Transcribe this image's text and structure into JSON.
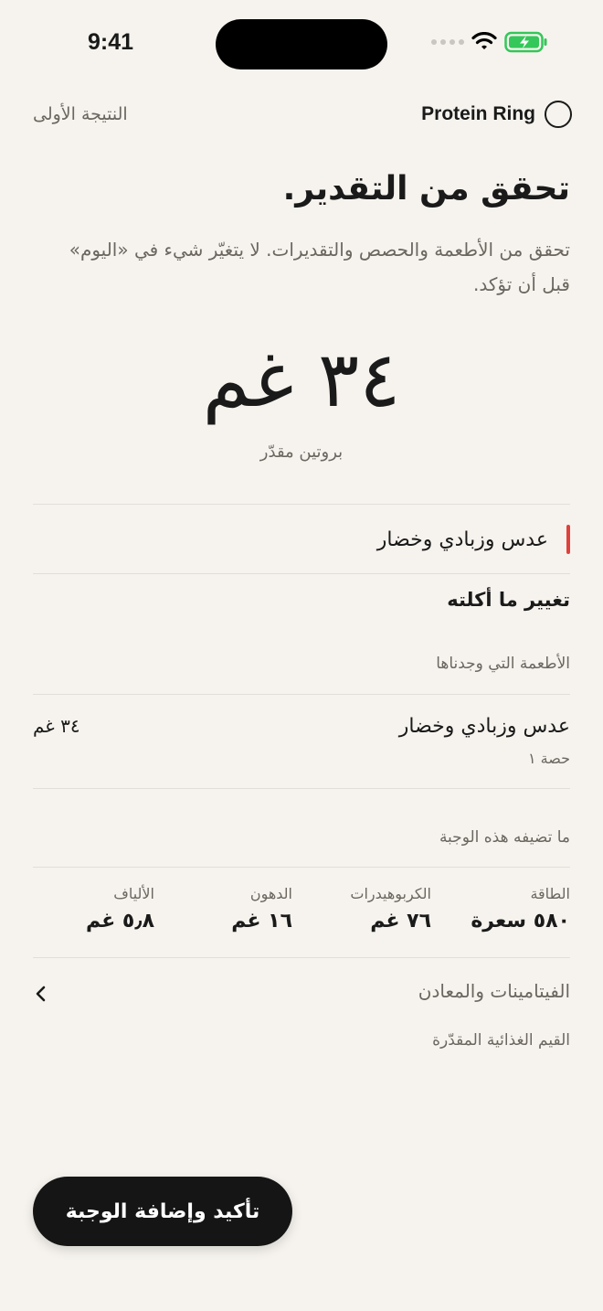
{
  "status": {
    "time": "9:41"
  },
  "header": {
    "brand": "Protein Ring",
    "first_result": "النتيجة الأولى"
  },
  "title": "تحقق من التقدير.",
  "subtitle": "تحقق من الأطعمة والحصص والتقديرات. لا يتغيّر شيء في «اليوم» قبل أن تؤكد.",
  "estimate": {
    "value": "٣٤ غم",
    "label": "بروتين مقدّر"
  },
  "meal": {
    "name": "عدس وزبادي وخضار",
    "accent_color": "#e0403c"
  },
  "change_label": "تغيير ما أكلته",
  "foods_section": {
    "label": "الأطعمة التي وجدناها",
    "items": [
      {
        "name": "عدس وزبادي وخضار",
        "portion": "حصة ١",
        "protein": "٣٤ غم"
      }
    ]
  },
  "meal_adds": {
    "label": "ما تضيفه هذه الوجبة",
    "nutrients": [
      {
        "label": "الطاقة",
        "value": "٥٨٠ سعرة"
      },
      {
        "label": "الكربوهيدرات",
        "value": "٧٦ غم"
      },
      {
        "label": "الدهون",
        "value": "١٦ غم"
      },
      {
        "label": "الألياف",
        "value": "٥٫٨ غم"
      }
    ]
  },
  "vitamins_label": "الفيتامينات والمعادن",
  "estimated_values_label": "القيم الغذائية المقدّرة",
  "confirm_button": "تأكيد وإضافة الوجبة",
  "colors": {
    "background": "#f6f3ee",
    "battery": "#34c759",
    "button": "#151515"
  }
}
